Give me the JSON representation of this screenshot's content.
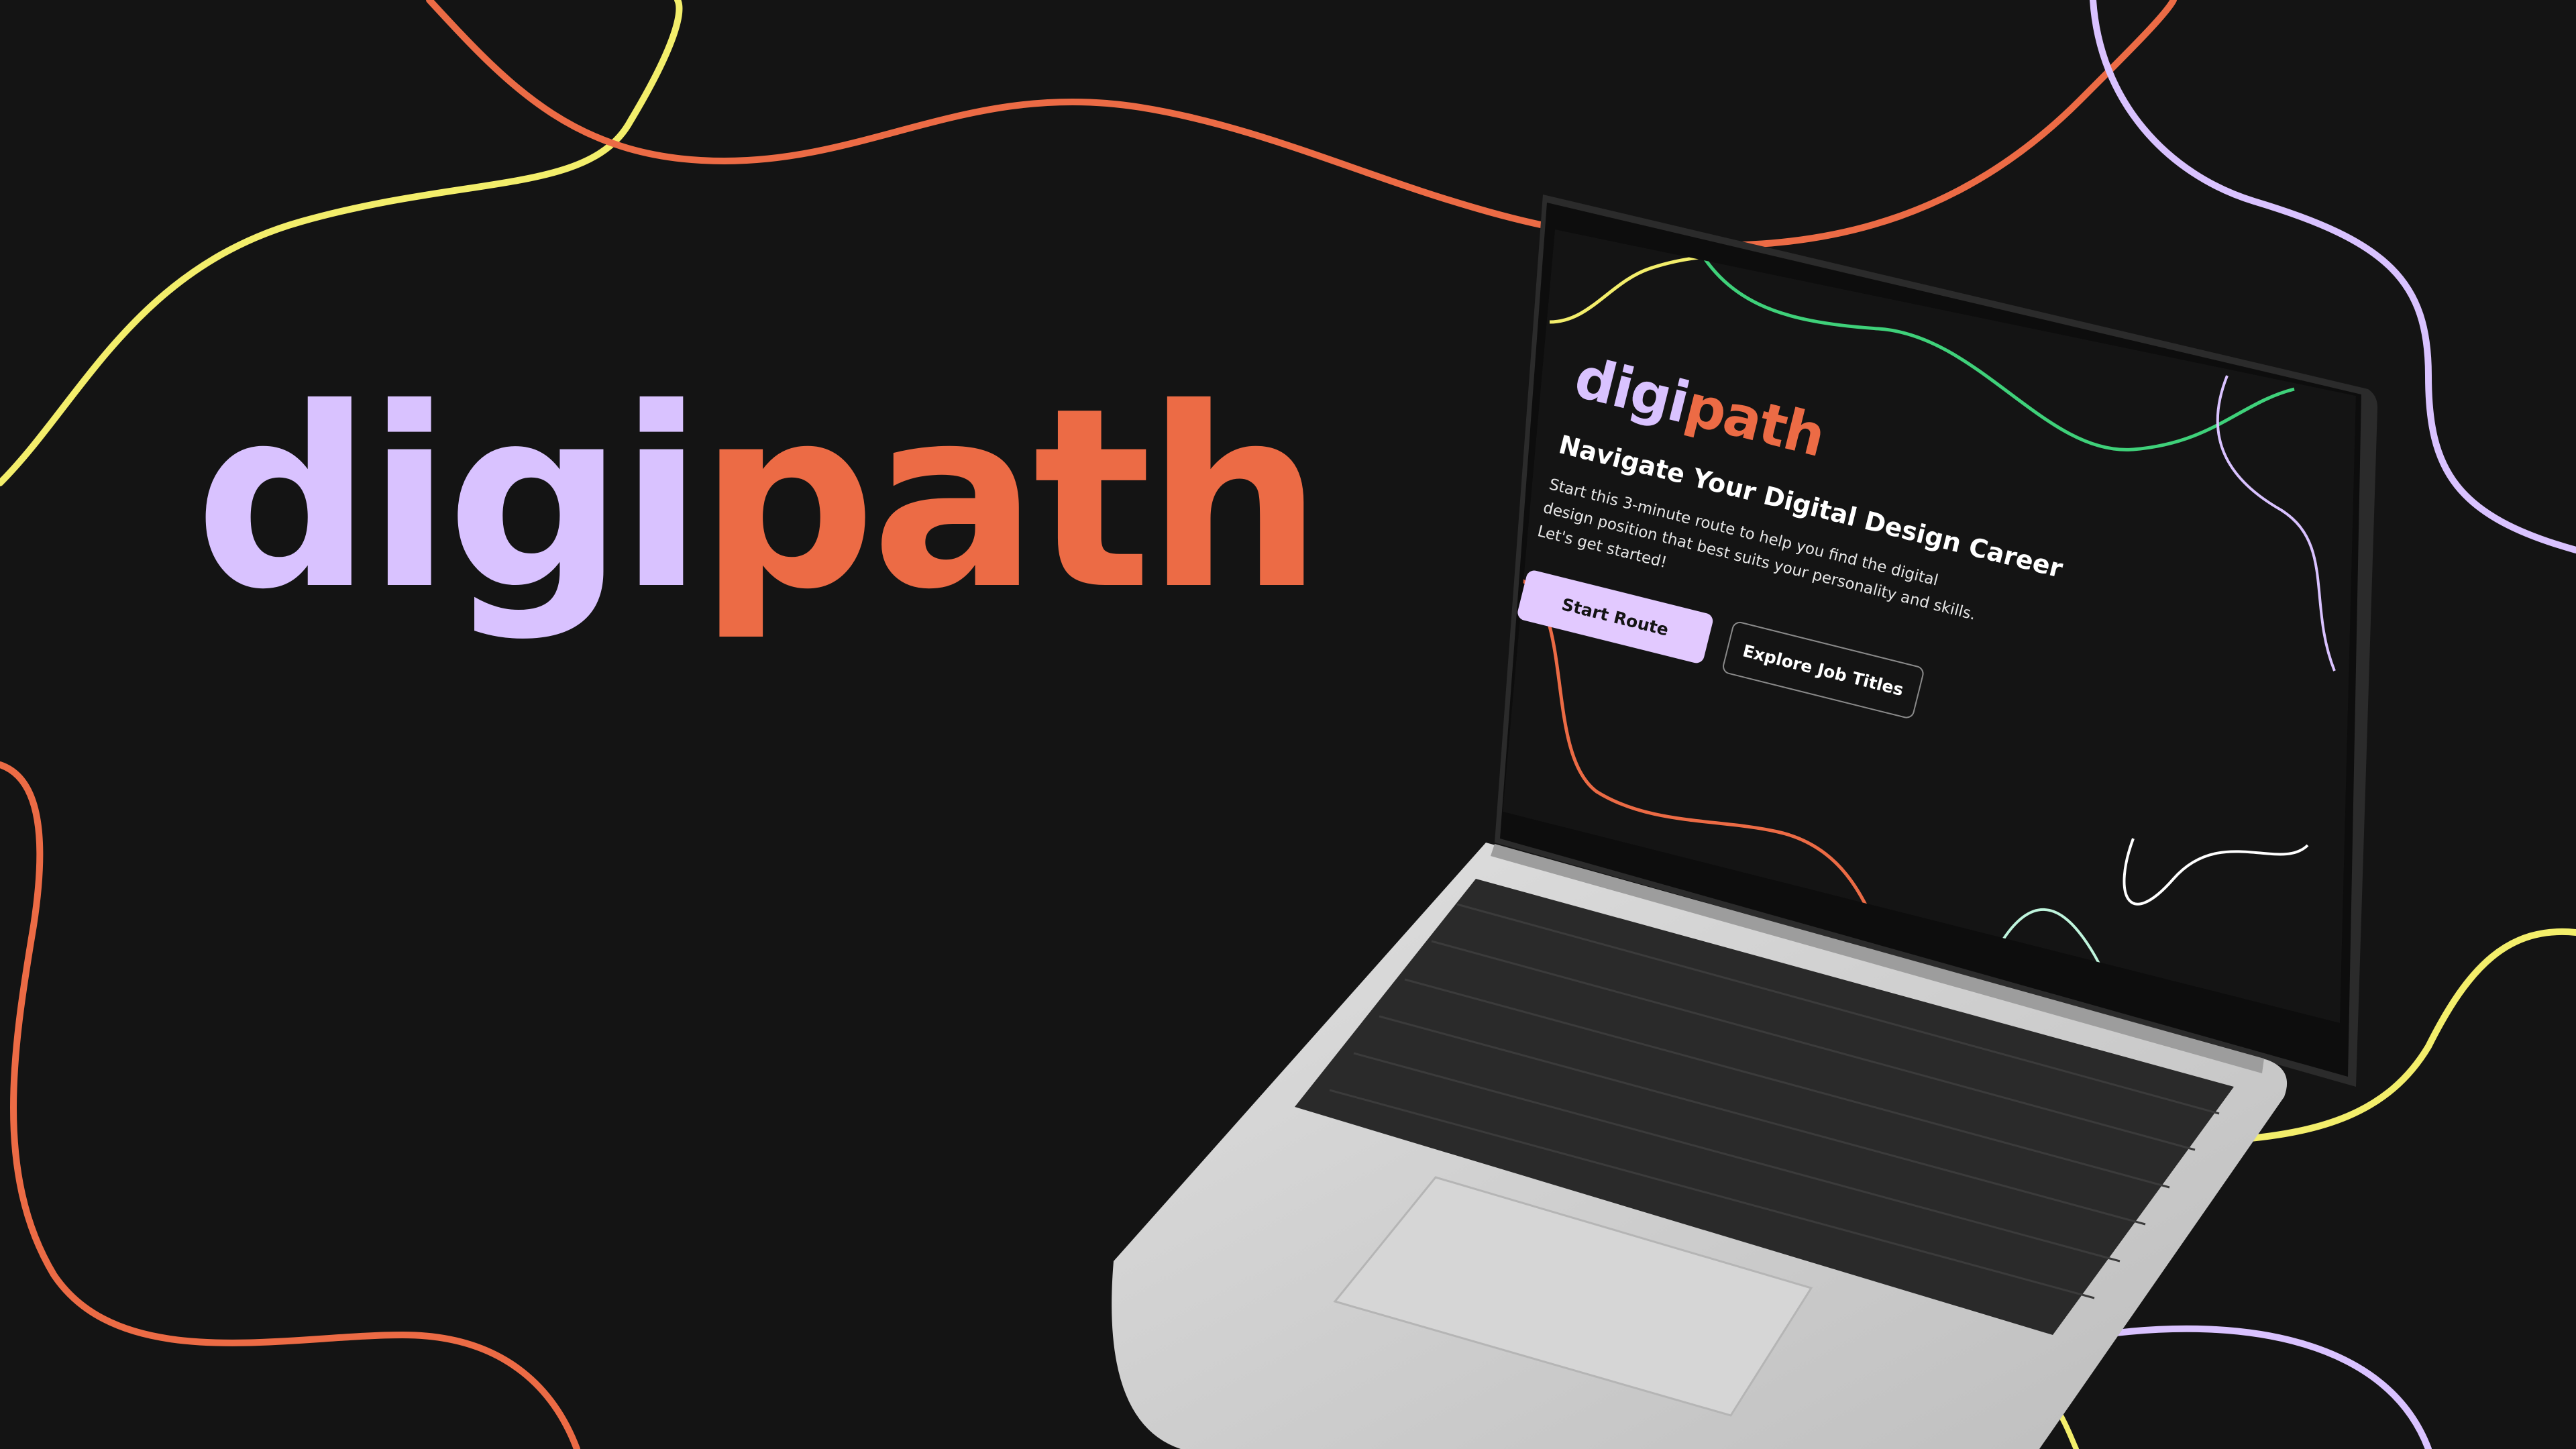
{
  "brand": {
    "part1": "digi",
    "part2": "path"
  },
  "colors": {
    "background": "#141414",
    "lavender": "#d9c2ff",
    "orange": "#ec6b45",
    "yellow": "#f3ee6b",
    "green": "#3fd17a",
    "mint": "#bff5dd",
    "laptop_silver": "#cfcfcf",
    "laptop_bezel": "#0d0d0d"
  },
  "screen": {
    "logo_part1": "digi",
    "logo_part2": "path",
    "headline": "Navigate Your Digital Design Career",
    "body": "Start this 3-minute route to help you find the digital design position that best suits your personality and skills. Let's get started!",
    "primary_button": "Start Route",
    "secondary_button": "Explore Job Titles"
  }
}
